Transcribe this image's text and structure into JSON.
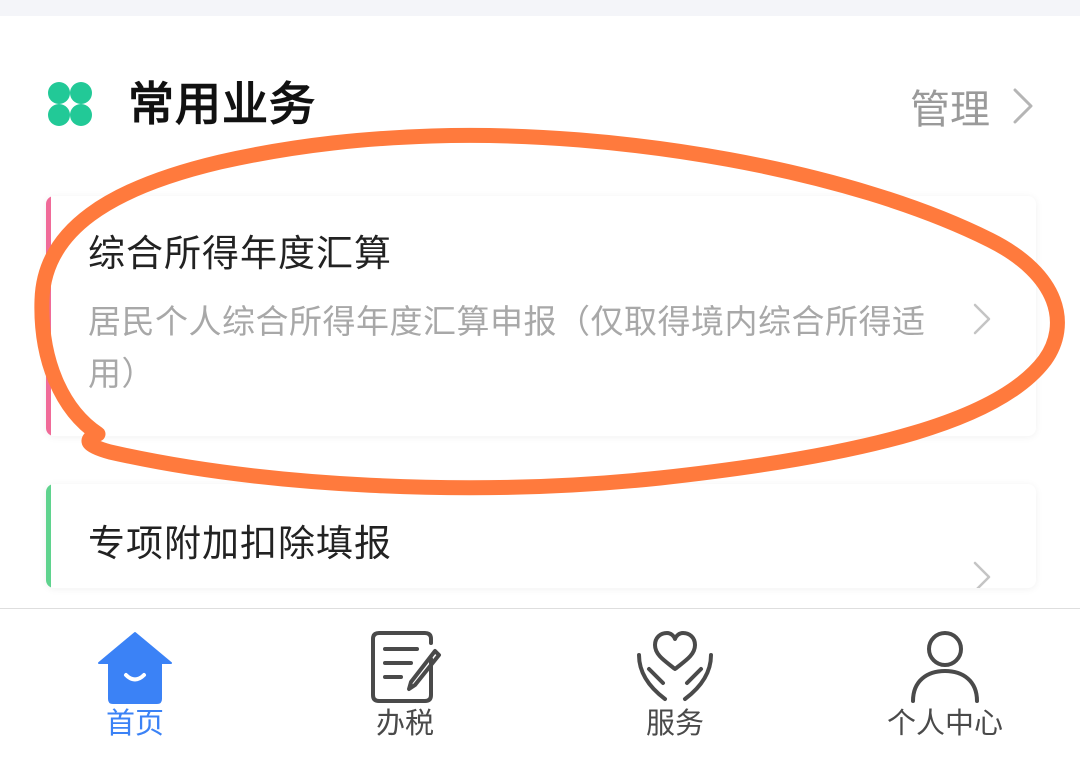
{
  "section": {
    "icon": "clover-icon",
    "title": "常用业务",
    "manage_label": "管理"
  },
  "cards": [
    {
      "title": "综合所得年度汇算",
      "description": "居民个人综合所得年度汇算申报（仅取得境内综合所得适用）",
      "accent_color": "#f06a98"
    },
    {
      "title": "专项附加扣除填报",
      "accent_color": "#5fd38e"
    }
  ],
  "tab_bar": {
    "tabs": [
      {
        "label": "首页",
        "icon": "home-icon",
        "active": true
      },
      {
        "label": "办税",
        "icon": "tax-form-icon",
        "active": false
      },
      {
        "label": "服务",
        "icon": "heart-hands-icon",
        "active": false
      },
      {
        "label": "个人中心",
        "icon": "person-icon",
        "active": false
      }
    ]
  },
  "colors": {
    "brand_green": "#22c997",
    "active_tab": "#3b82f6",
    "annotation_orange": "#ff7a3d",
    "muted_text": "#a8a8a8"
  }
}
